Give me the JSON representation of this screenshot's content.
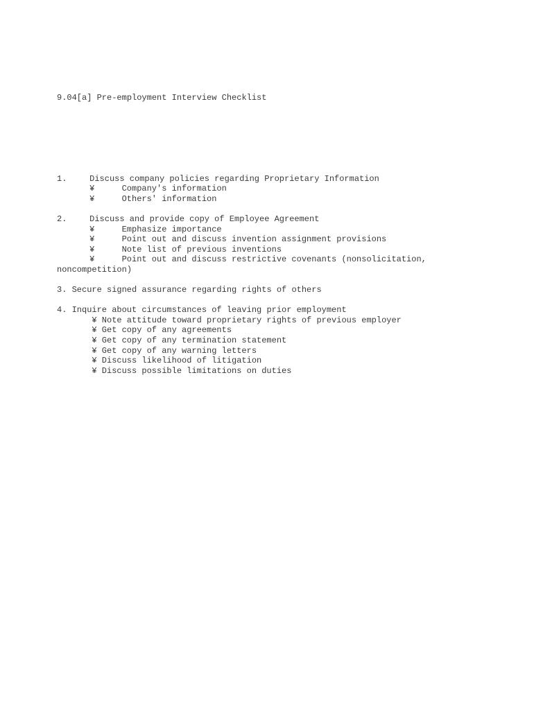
{
  "document": {
    "title": "9.04[a] Pre-employment Interview Checklist",
    "bullet_glyph": "¥",
    "text_color": "#3a3a3a",
    "background_color": "#ffffff",
    "sections": [
      {
        "number": "1.",
        "heading": "Discuss company policies regarding Proprietary Information",
        "indent_style": "A",
        "items": [
          "Company's information",
          "Others' information"
        ],
        "continuation": null
      },
      {
        "number": "2.",
        "heading": "Discuss and provide copy of Employee Agreement",
        "indent_style": "A",
        "items": [
          "Emphasize importance",
          "Point out and discuss invention assignment provisions",
          "Note list of previous inventions",
          "Point out and discuss restrictive covenants (nonsolicitation,"
        ],
        "continuation": "noncompetition)"
      },
      {
        "number": "3.",
        "heading": "Secure signed assurance regarding rights of others",
        "indent_style": "B",
        "items": [],
        "continuation": null
      },
      {
        "number": "4.",
        "heading": "Inquire about circumstances of leaving prior employment",
        "indent_style": "B",
        "items": [
          "Note attitude toward proprietary rights of previous employer",
          "Get copy of any agreements",
          "Get copy of any termination statement",
          "Get copy of any warning letters",
          "Discuss likelihood of litigation",
          "Discuss possible limitations on duties"
        ],
        "continuation": null
      }
    ]
  }
}
